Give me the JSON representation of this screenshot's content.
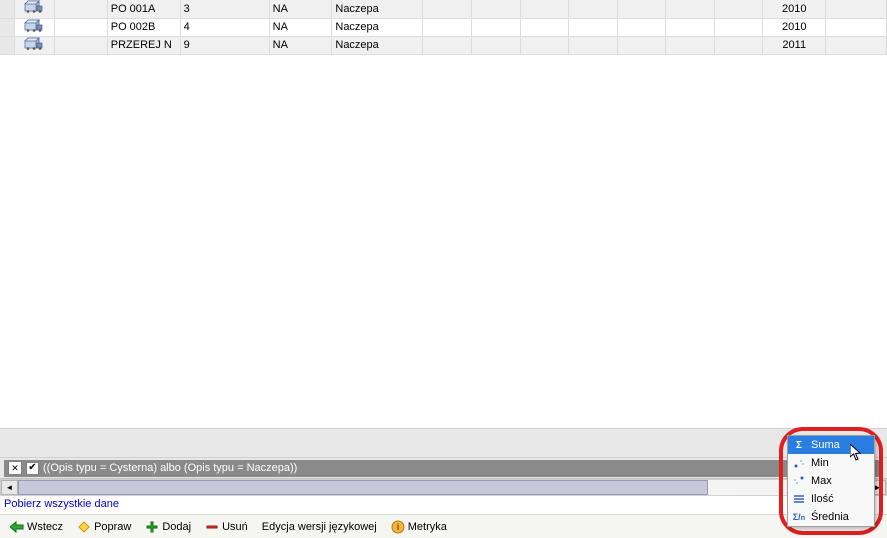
{
  "rows": [
    {
      "reg": "PO 001A",
      "num": "3",
      "code": "NA",
      "type": "Naczepa",
      "year": "2010"
    },
    {
      "reg": "PO 002B",
      "num": "4",
      "code": "NA",
      "type": "Naczepa",
      "year": "2010"
    },
    {
      "reg": "PRZEREJ N",
      "num": "9",
      "code": "NA",
      "type": "Naczepa",
      "year": "2011"
    }
  ],
  "filter": {
    "text": "((Opis typu = Cysterna) albo (Opis typu = Naczepa))",
    "link": "Pobierz wszystkie dane"
  },
  "toolbar": {
    "back": "Wstecz",
    "edit": "Popraw",
    "add": "Dodaj",
    "del": "Usuń",
    "lang": "Edycja wersji językowej",
    "metric": "Metryka"
  },
  "ctx": {
    "sum": "Suma",
    "min": "Min",
    "max": "Max",
    "count": "Ilość",
    "avg": "Średnia"
  }
}
